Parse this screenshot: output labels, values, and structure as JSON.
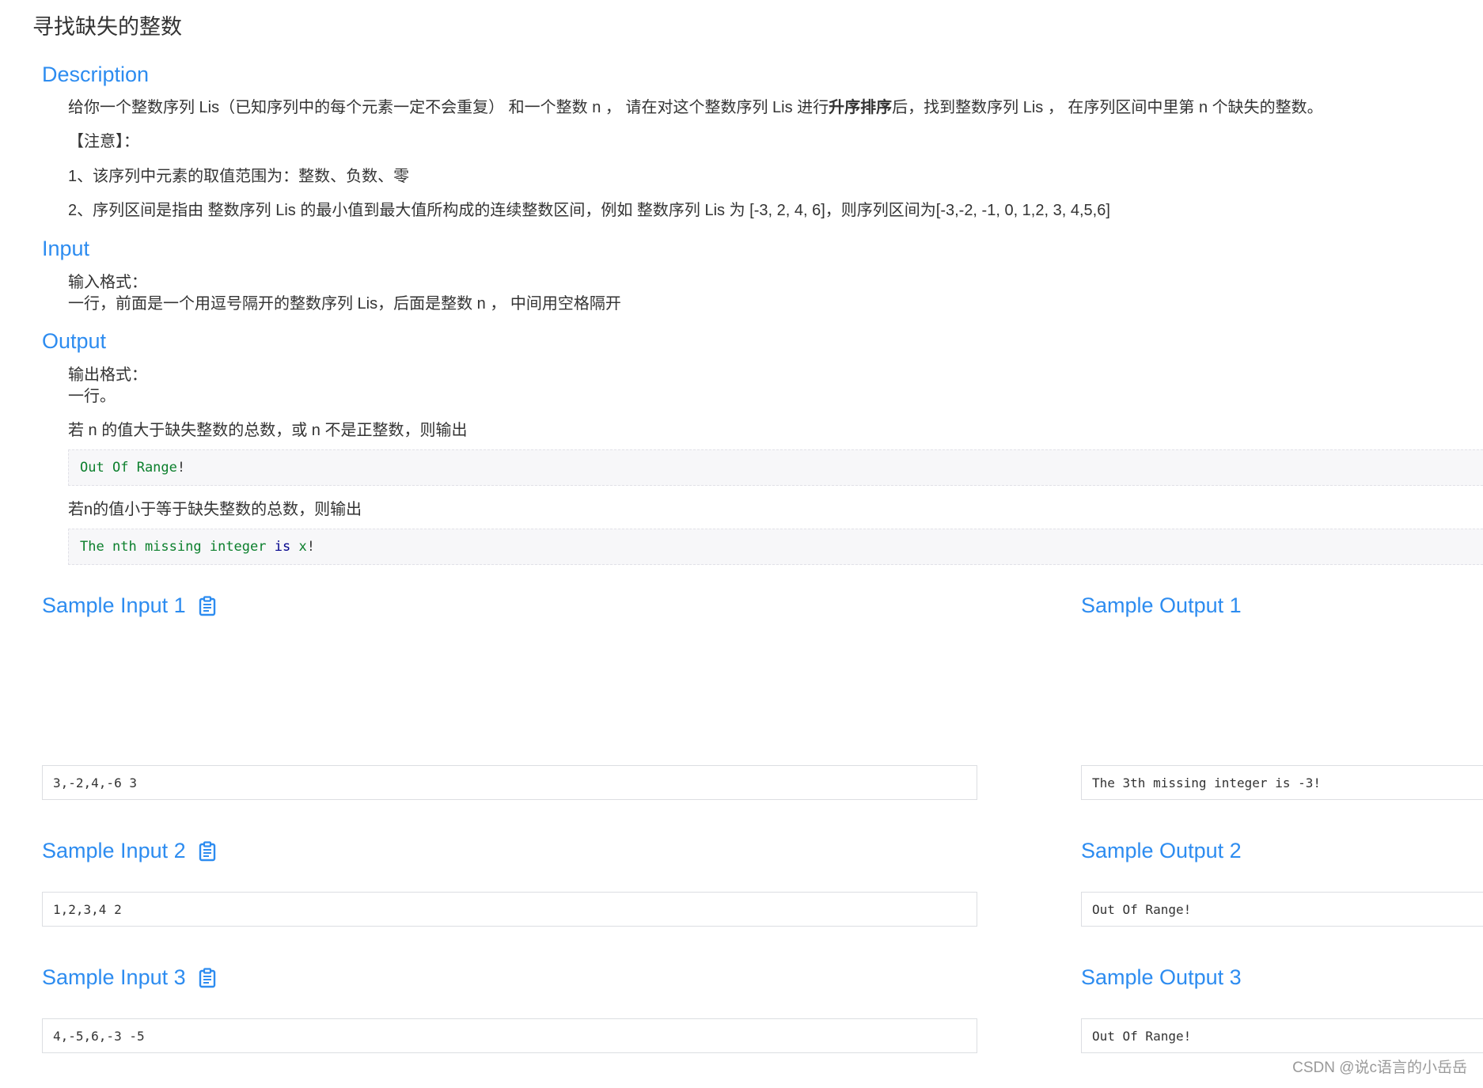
{
  "page": {
    "title": "寻找缺失的整数"
  },
  "description": {
    "heading": "Description",
    "para1_a": "给你一个整数序列 Lis（已知序列中的每个元素一定不会重复） 和一个整数 n ， 请在对这个整数序列 Lis 进行",
    "para1_bold": "升序排序",
    "para1_b": "后，找到整数序列 Lis ， 在序列区间中里第 n 个缺失的整数。",
    "note": "【注意】：",
    "note1": "1、该序列中元素的取值范围为：整数、负数、零",
    "note2": "2、序列区间是指由 整数序列 Lis 的最小值到最大值所构成的连续整数区间，例如 整数序列 Lis 为 [-3, 2, 4, 6]，则序列区间为[-3,-2, -1, 0, 1,2, 3, 4,5,6]"
  },
  "input": {
    "heading": "Input",
    "line1": "输入格式：",
    "line2": "一行，前面是一个用逗号隔开的整数序列 Lis，后面是整数 n ， 中间用空格隔开"
  },
  "output": {
    "heading": "Output",
    "line1": "输出格式：",
    "line2": "一行。",
    "cond1": "若 n 的值大于缺失整数的总数，或 n 不是正整数，则输出",
    "code1_a": "Out",
    "code1_b": "Of",
    "code1_c": "Range",
    "code1_d": "!",
    "cond2": "若n的值小于等于缺失整数的总数，则输出",
    "code2_a": "The",
    "code2_b": "nth",
    "code2_c": "missing",
    "code2_d": "integer",
    "code2_e": "is",
    "code2_f": "x",
    "code2_g": "!"
  },
  "samples": [
    {
      "input_title": "Sample Input 1",
      "input": "3,-2,4,-6 3",
      "output_title": "Sample Output 1",
      "output": "The 3th missing integer is -3!"
    },
    {
      "input_title": "Sample Input 2",
      "input": "1,2,3,4 2",
      "output_title": "Sample Output 2",
      "output": "Out Of Range!"
    },
    {
      "input_title": "Sample Input 3",
      "input": "4,-5,6,-3 -5",
      "output_title": "Sample Output 3",
      "output": "Out Of Range!"
    }
  ],
  "icons": {
    "copy": "clipboard-icon"
  },
  "colors": {
    "accent": "#2d8cf0",
    "code_green": "#0b7f2c",
    "code_keyword": "#00008b"
  },
  "watermark": "CSDN @说c语言的小岳岳"
}
